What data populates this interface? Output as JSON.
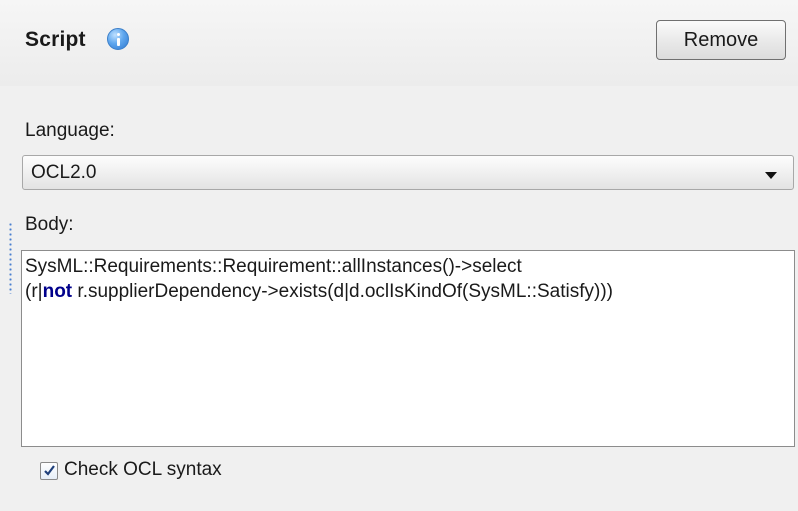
{
  "header": {
    "title": "Script",
    "remove_label": "Remove"
  },
  "language": {
    "label": "Language:",
    "selected": "OCL2.0"
  },
  "body": {
    "label": "Body:",
    "line1": "SysML::Requirements::Requirement::allInstances()->select",
    "line2_pre": "(r|",
    "line2_keyword": "not",
    "line2_post": " r.supplierDependency->exists(d|d.oclIsKindOf(SysML::Satisfy)))"
  },
  "check_syntax": {
    "label": "Check OCL syntax",
    "checked": true
  },
  "colors": {
    "keyword": "#00008b",
    "info_icon": "#2e78d0",
    "drag_handle": "#4a7fd0"
  },
  "icons": {
    "info": "info-icon",
    "dropdown": "chevron-down-icon",
    "checkbox": "checkmark-icon"
  }
}
